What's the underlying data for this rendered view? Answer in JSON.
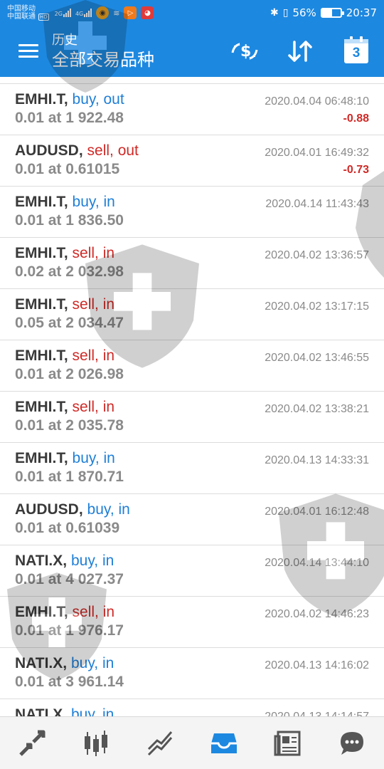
{
  "status_bar": {
    "carrier_1": "中国移动",
    "carrier_2": "中国联通",
    "hd": "HD",
    "net_1": "2G",
    "net_2": "4G",
    "battery": "56%",
    "time": "20:37"
  },
  "header": {
    "title_small": "历史",
    "title_big": "全部交易品种",
    "calendar_day": "3"
  },
  "deals": [
    {
      "symbol": "EMHI.T,",
      "side": "buy, out",
      "side_type": "buy",
      "volume": "0.01 at 1 922.48",
      "time": "2020.04.04 06:48:10",
      "profit": "-0.88"
    },
    {
      "symbol": "AUDUSD,",
      "side": "sell, out",
      "side_type": "sell",
      "volume": "0.01 at 0.61015",
      "time": "2020.04.01 16:49:32",
      "profit": "-0.73"
    },
    {
      "symbol": "EMHI.T,",
      "side": "buy, in",
      "side_type": "buy",
      "volume": "0.01 at 1 836.50",
      "time": "2020.04.14 11:43:43",
      "profit": ""
    },
    {
      "symbol": "EMHI.T,",
      "side": "sell, in",
      "side_type": "sell",
      "volume": "0.02 at 2 032.98",
      "time": "2020.04.02 13:36:57",
      "profit": ""
    },
    {
      "symbol": "EMHI.T,",
      "side": "sell, in",
      "side_type": "sell",
      "volume": "0.05 at 2 034.47",
      "time": "2020.04.02 13:17:15",
      "profit": ""
    },
    {
      "symbol": "EMHI.T,",
      "side": "sell, in",
      "side_type": "sell",
      "volume": "0.01 at 2 026.98",
      "time": "2020.04.02 13:46:55",
      "profit": ""
    },
    {
      "symbol": "EMHI.T,",
      "side": "sell, in",
      "side_type": "sell",
      "volume": "0.01 at 2 035.78",
      "time": "2020.04.02 13:38:21",
      "profit": ""
    },
    {
      "symbol": "EMHI.T,",
      "side": "buy, in",
      "side_type": "buy",
      "volume": "0.01 at 1 870.71",
      "time": "2020.04.13 14:33:31",
      "profit": ""
    },
    {
      "symbol": "AUDUSD,",
      "side": "buy, in",
      "side_type": "buy",
      "volume": "0.01 at 0.61039",
      "time": "2020.04.01 16:12:48",
      "profit": ""
    },
    {
      "symbol": "NATI.X,",
      "side": "buy, in",
      "side_type": "buy",
      "volume": "0.01 at 4 027.37",
      "time": "2020.04.14 13:44:10",
      "profit": ""
    },
    {
      "symbol": "EMHI.T,",
      "side": "sell, in",
      "side_type": "sell",
      "volume": "0.01 at 1 976.17",
      "time": "2020.04.02 14:46:23",
      "profit": ""
    },
    {
      "symbol": "NATI.X,",
      "side": "buy, in",
      "side_type": "buy",
      "volume": "0.01 at 3 961.14",
      "time": "2020.04.13 14:16:02",
      "profit": ""
    },
    {
      "symbol": "NATI.X,",
      "side": "buy, in",
      "side_type": "buy",
      "volume": "",
      "time": "2020.04.13 14:14:57",
      "profit": ""
    }
  ],
  "bottom_nav": [
    {
      "icon": "quotes-icon",
      "active": false
    },
    {
      "icon": "chart-icon",
      "active": false
    },
    {
      "icon": "trade-icon",
      "active": false
    },
    {
      "icon": "history-icon",
      "active": true
    },
    {
      "icon": "news-icon",
      "active": false
    },
    {
      "icon": "chat-icon",
      "active": false
    }
  ],
  "colors": {
    "primary": "#1d88e0",
    "buy": "#1f7fd6",
    "sell": "#cf2a27",
    "muted": "#8a8a8a"
  }
}
